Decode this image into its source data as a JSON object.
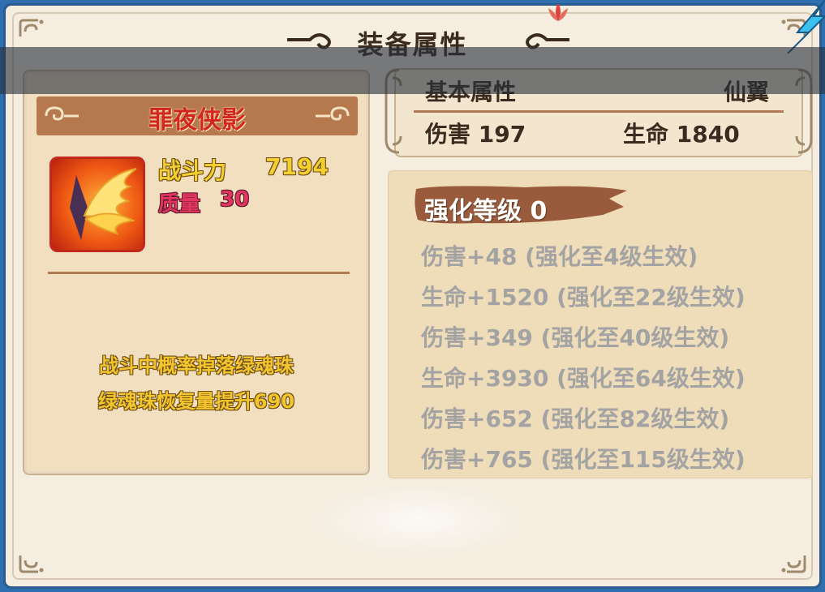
{
  "window": {
    "title": "装备属性"
  },
  "item": {
    "name": "罪夜侠影",
    "power_label": "战斗力",
    "power_value": "7194",
    "quality_label": "质量",
    "quality_value": "30",
    "effects": [
      "战斗中概率掉落绿魂珠",
      "绿魂珠恢复量提升690"
    ],
    "icon": "golden-wings-icon"
  },
  "base_attributes": {
    "title": "基本属性",
    "type": "仙翼",
    "damage": "伤害 197",
    "hp": "生命 1840"
  },
  "enhancement": {
    "level_label": "强化等级 0",
    "bonuses": [
      "伤害+48 (强化至4级生效)",
      "生命+1520 (强化至22级生效)",
      "伤害+349 (强化至40级生效)",
      "生命+3930 (强化至64级生效)",
      "伤害+652 (强化至82级生效)",
      "伤害+765 (强化至115级生效)"
    ]
  },
  "colors": {
    "frame_blue": "#2a5c92",
    "panel_tan": "#f1dfbf",
    "name_red": "#d1251e",
    "power_gold": "#f3d02f",
    "quality_pink": "#e2365f",
    "inactive_gray": "#a3a3a3"
  }
}
